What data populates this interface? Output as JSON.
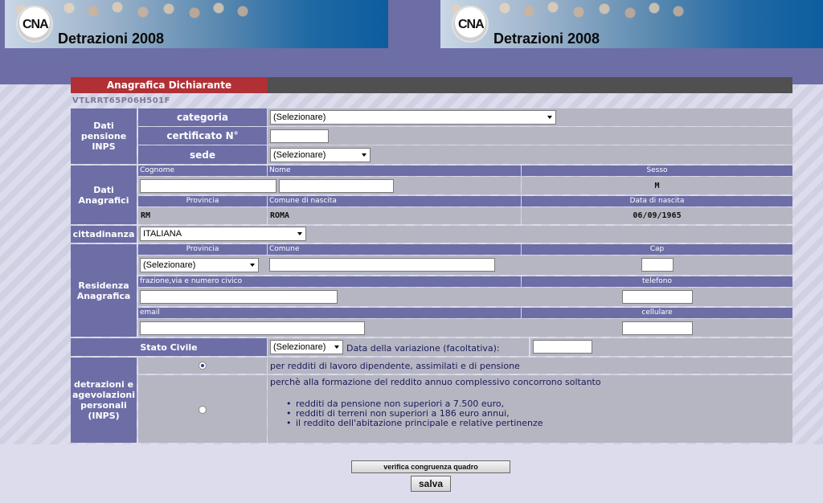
{
  "header": {
    "brand_left": "Detrazioni 2008",
    "brand_right": "Detrazioni 2008",
    "logo_text_left": "CNA",
    "logo_text_right": "CNA"
  },
  "section": {
    "title": "Anagrafica Dichiarante",
    "codice_fiscale": "VTLRRT65P06H501F"
  },
  "pensione": {
    "group_label": "Dati pensione INPS",
    "categoria_label": "categoria",
    "categoria_value": "(Selezionare)",
    "certificato_label": "certificato N°",
    "certificato_value": "",
    "sede_label": "sede",
    "sede_value": "(Selezionare)"
  },
  "anagrafici": {
    "group_label": "Dati Anagrafici",
    "cognome_label": "Cognome",
    "nome_label": "Nome",
    "sesso_label": "Sesso",
    "sesso_value": "M",
    "provincia_label": "Provincia",
    "provincia_value": "RM",
    "comune_label": "Comune di nascita",
    "comune_value": "ROMA",
    "data_label": "Data di nascita",
    "data_value": "06/09/1965"
  },
  "cittadinanza": {
    "label": "cittadinanza",
    "value": "ITALIANA"
  },
  "residenza": {
    "group_label": "Residenza Anagrafica",
    "provincia_label": "Provincia",
    "provincia_value": "(Selezionare)",
    "comune_label": "Comune",
    "cap_label": "Cap",
    "via_label": "frazione,via e numero civico",
    "telefono_label": "telefono",
    "email_label": "email",
    "cellulare_label": "cellulare"
  },
  "stato_civile": {
    "label": "Stato Civile",
    "value": "(Selezionare)",
    "variazione_label": "Data della variazione (facoltativa):"
  },
  "detrazioni": {
    "group_label": "detrazioni e agevolazioni personali (INPS)",
    "option1": "per redditi di lavoro dipendente, assimilati e di pensione",
    "option2_intro": "perchè alla formazione del reddito annuo complessivo concorrono soltanto",
    "option2_items": [
      "redditi da pensione non superiori a 7.500 euro,",
      "redditi di terreni non superiori a 186 euro annui,",
      "il reddito dell'abitazione principale e relative pertinenze"
    ]
  },
  "buttons": {
    "verifica": "verifica congruenza quadro",
    "salva": "salva"
  },
  "colors": {
    "label_bg": "#6d6ea6",
    "field_bg": "#b5b6c1",
    "title_tab": "#b03036"
  }
}
